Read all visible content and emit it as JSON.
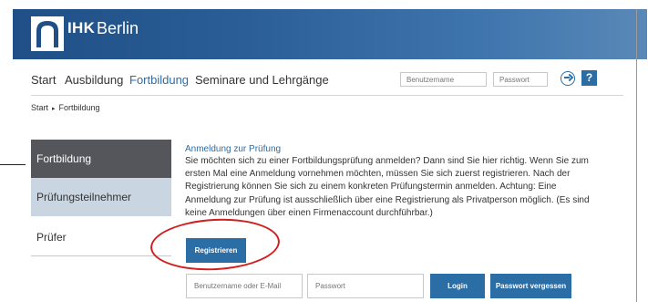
{
  "header": {
    "logo_text": "IHK",
    "city": "Berlin"
  },
  "nav": {
    "items": [
      {
        "label": "Start"
      },
      {
        "label": "Ausbildung"
      },
      {
        "label": "Fortbildung"
      },
      {
        "label": "Seminare und Lehrgänge"
      }
    ],
    "active": "Fortbildung"
  },
  "top_login": {
    "username_placeholder": "Benutzername",
    "password_placeholder": "Passwort",
    "help_label": "?"
  },
  "breadcrumb": {
    "items": [
      "Start",
      "Fortbildung"
    ],
    "separator": "▸"
  },
  "sidebar": {
    "items": [
      {
        "label": "Fortbildung"
      },
      {
        "label": "Prüfungsteilnehmer"
      },
      {
        "label": "Prüfer"
      }
    ]
  },
  "content": {
    "title": "Anmeldung zur Prüfung",
    "text": "Sie möchten sich zu einer Fortbildungsprüfung anmelden? Dann sind Sie hier richtig. Wenn Sie zum ersten Mal eine Anmeldung vornehmen möchten, müssen Sie sich zuerst registrieren. Nach der Registrierung können Sie sich zu einem konkreten Prüfungstermin anmelden. Achtung: Eine Anmeldung zur Prüfung ist ausschließlich über eine Registrierung als Privatperson möglich. (Es sind keine Anmeldungen über einen Firmenaccount durchführbar.)",
    "register_label": "Registrieren"
  },
  "bottom_login": {
    "username_placeholder": "Benutzername oder E-Mail",
    "password_placeholder": "Passwort",
    "login_label": "Login",
    "forgot_label": "Passwort vergessen"
  },
  "colors": {
    "brand_blue": "#2b6da5",
    "header_dark": "#1f4f86",
    "sidebar_active": "#55565b",
    "sidebar_light": "#c9d5e0",
    "highlight_red": "#d01f1f"
  },
  "icons": {
    "go": "arrow-circle-icon",
    "help": "help-icon",
    "breadcrumb_sep": "triangle-right-icon"
  }
}
